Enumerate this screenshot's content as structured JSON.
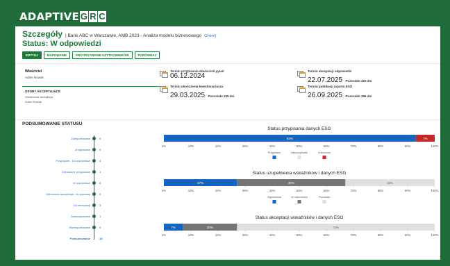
{
  "brand": {
    "name": "ADAPTIVE",
    "letters": [
      "G",
      "R",
      "C"
    ]
  },
  "header": {
    "title": "Szczegóły",
    "subtitle": "| Bank ABC w Warszawie, AMB 2023 - Analiza modelu biznesowego",
    "change_link": "(Zmień)",
    "status": "Status: W odpowiedzi"
  },
  "tabs": [
    "EDYTUJ",
    "MAPOWANIE",
    "PRZYPISYWANIE UŻYTKOWNIKÓW",
    "PORÓWNAJ"
  ],
  "owner": {
    "label": "Właściciel",
    "name": "Adam Nowak"
  },
  "persons": {
    "label": "OSOBY AKCEPTUJĄCE",
    "sub": "Ostateczna akceptacja",
    "name": "Adam Nowak"
  },
  "deadlines": [
    {
      "label": "Termin przypisania właścicieli pytań",
      "date": "06.12.2024",
      "remaining": ""
    },
    {
      "label": "Termin ukończenia kwestionariusza",
      "date": "29.03.2025",
      "remaining": "Pozostało 205 dni"
    },
    {
      "label": "Termin akceptacji odpowiedzi",
      "date": "22.07.2025",
      "remaining": "Pozostało 320 dni"
    },
    {
      "label": "Termin publikacji raportu ESG",
      "date": "26.09.2025",
      "remaining": "Pozostało 386 dni"
    }
  ],
  "summary": {
    "title": "PODSUMOWANIE STATUSU",
    "items": [
      {
        "label": "Zaimportowane",
        "value": "0"
      },
      {
        "label": "Zmapowane",
        "value": "0"
      },
      {
        "label": "Przypisane - Do odpowiedzi",
        "value": "4"
      },
      {
        "label": "Odrzucone przypisanie",
        "value": "1"
      },
      {
        "label": "W odpowiedzi",
        "value": "6"
      },
      {
        "label": "Odrzucona akceptacja - do poprawy",
        "value": "0"
      },
      {
        "label": "Do akceptacji",
        "value": "3"
      },
      {
        "label": "Zaakceptowane",
        "value": "1"
      },
      {
        "label": "Wyeksportowane",
        "value": "0"
      }
    ],
    "total": {
      "label": "Podsumowanie",
      "value": "15"
    }
  },
  "colors": {
    "brand_green": "#1f6b3a",
    "blue": "#1565c0",
    "red": "#c62828",
    "gray": "#757575",
    "light_gray": "#e0e0e0"
  },
  "chart_data": [
    {
      "type": "bar",
      "orientation": "horizontal-stacked",
      "title": "Status przypisania danych ESG",
      "xlim": [
        0,
        100
      ],
      "ticks": [
        "0%",
        "10%",
        "20%",
        "30%",
        "40%",
        "50%",
        "60%",
        "70%",
        "80%",
        "90%",
        "100%"
      ],
      "series": [
        {
          "name": "Przypisane",
          "value": 93,
          "label": "93%",
          "color": "#1565c0"
        },
        {
          "name": "Nieprzypisane",
          "value": 0,
          "label": "",
          "color": "#e0e0e0"
        },
        {
          "name": "Odrzucone",
          "value": 7,
          "label": "7%",
          "color": "#c62828"
        }
      ]
    },
    {
      "type": "bar",
      "orientation": "horizontal-stacked",
      "title": "Status uzupełnienia wskaźników i danych ESG",
      "xlim": [
        0,
        100
      ],
      "ticks": [
        "0%",
        "10%",
        "20%",
        "30%",
        "40%",
        "50%",
        "60%",
        "70%",
        "80%",
        "90%",
        "100%"
      ],
      "series": [
        {
          "name": "Wypełnione",
          "value": 27,
          "label": "27%",
          "color": "#1565c0"
        },
        {
          "name": "W odpowiedzi",
          "value": 40,
          "label": "40%",
          "color": "#757575"
        },
        {
          "name": "Pozostałe",
          "value": 33,
          "label": "33%",
          "color": "#e0e0e0"
        }
      ]
    },
    {
      "type": "bar",
      "orientation": "horizontal-stacked",
      "title": "Status akceptacji wskaźników i danych ESG",
      "xlim": [
        0,
        100
      ],
      "ticks": [
        "0%",
        "10%",
        "20%",
        "30%",
        "40%",
        "50%",
        "60%",
        "70%",
        "80%",
        "90%",
        "100%"
      ],
      "series": [
        {
          "name": "",
          "value": 7,
          "label": "7%",
          "color": "#1565c0"
        },
        {
          "name": "",
          "value": 20,
          "label": "20%",
          "color": "#757575"
        },
        {
          "name": "",
          "value": 73,
          "label": "73%",
          "color": "#e0e0e0"
        }
      ]
    }
  ]
}
